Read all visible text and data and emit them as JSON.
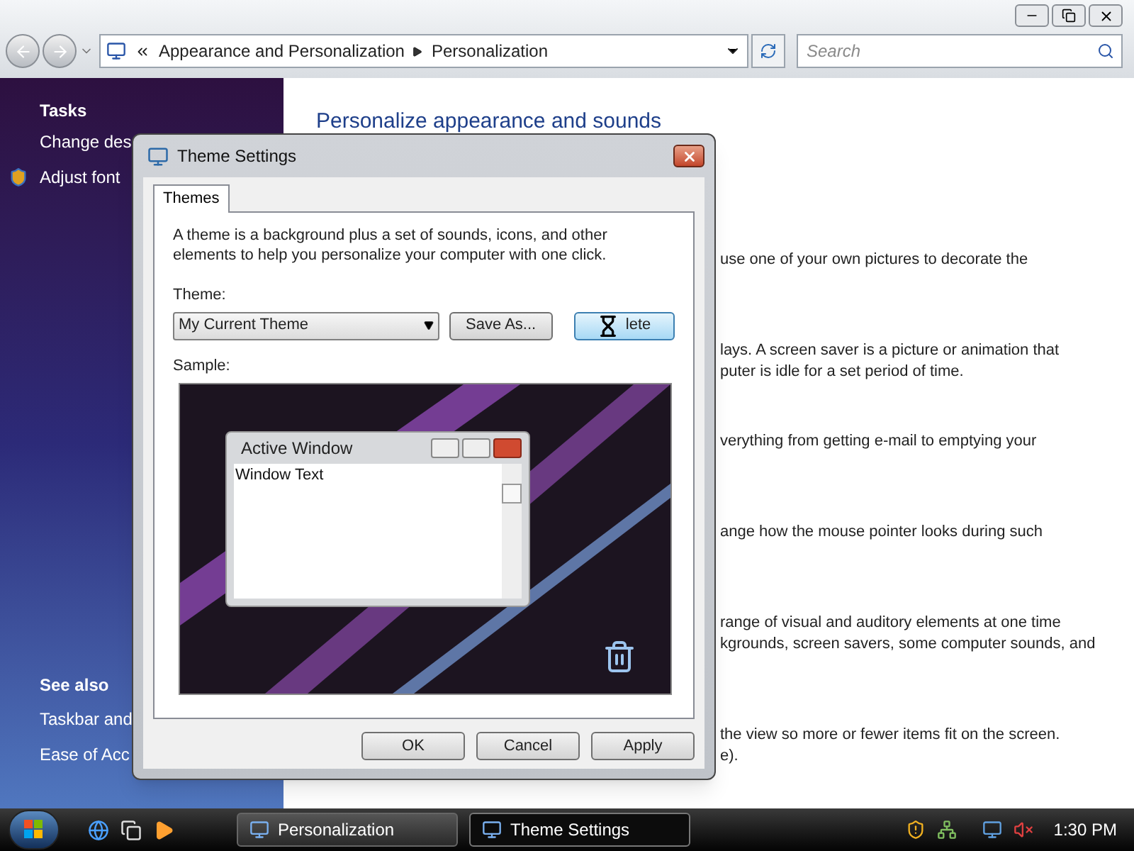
{
  "explorer": {
    "address": {
      "crumbs": [
        "Appearance and Personalization",
        "Personalization"
      ]
    },
    "search": {
      "placeholder": "Search"
    }
  },
  "sidebar": {
    "tasks_heading": "Tasks",
    "tasks": [
      {
        "label": "Change des",
        "kind": "plain"
      },
      {
        "label": "Adjust font",
        "kind": "shield"
      }
    ],
    "see_also_heading": "See also",
    "see_also": [
      "Taskbar and",
      "Ease of Acc"
    ]
  },
  "content": {
    "heading": "Personalize appearance and sounds",
    "fragments": [
      {
        "lines": [
          "use one of your own pictures to decorate the"
        ]
      },
      {
        "lines": [
          "lays. A screen saver is a picture or animation that",
          "puter is idle for a set period of time."
        ]
      },
      {
        "lines": [
          "verything from getting e-mail to emptying your"
        ]
      },
      {
        "lines": [
          "ange how the mouse pointer looks during such"
        ]
      },
      {
        "lines": [
          "range of visual and auditory elements at one time",
          "kgrounds, screen savers, some computer sounds, and"
        ]
      },
      {
        "lines": [
          "the view so more or fewer items fit on the screen.",
          "e)."
        ]
      }
    ]
  },
  "dialog": {
    "title": "Theme Settings",
    "tabs": [
      {
        "label": "Themes",
        "selected": true
      }
    ],
    "description": "A theme is a background plus a set of sounds, icons, and other elements to help you personalize your computer with one click.",
    "theme_label": "Theme:",
    "theme_value": "My Current Theme",
    "theme_buttons": [
      {
        "label": "Save As...",
        "focused": false,
        "cursor": false
      },
      {
        "label": "lete",
        "focused": true,
        "cursor": true
      }
    ],
    "sample_label": "Sample:",
    "sample_window": {
      "title": "Active Window",
      "text": "Window Text"
    },
    "buttons": [
      {
        "label": "OK",
        "focused": false
      },
      {
        "label": "Cancel",
        "focused": false
      },
      {
        "label": "Apply",
        "focused": false
      }
    ]
  },
  "taskbar": {
    "buttons": [
      {
        "label": "Personalization",
        "selected": false
      },
      {
        "label": "Theme Settings",
        "selected": true
      }
    ],
    "clock": "1:30 PM"
  }
}
